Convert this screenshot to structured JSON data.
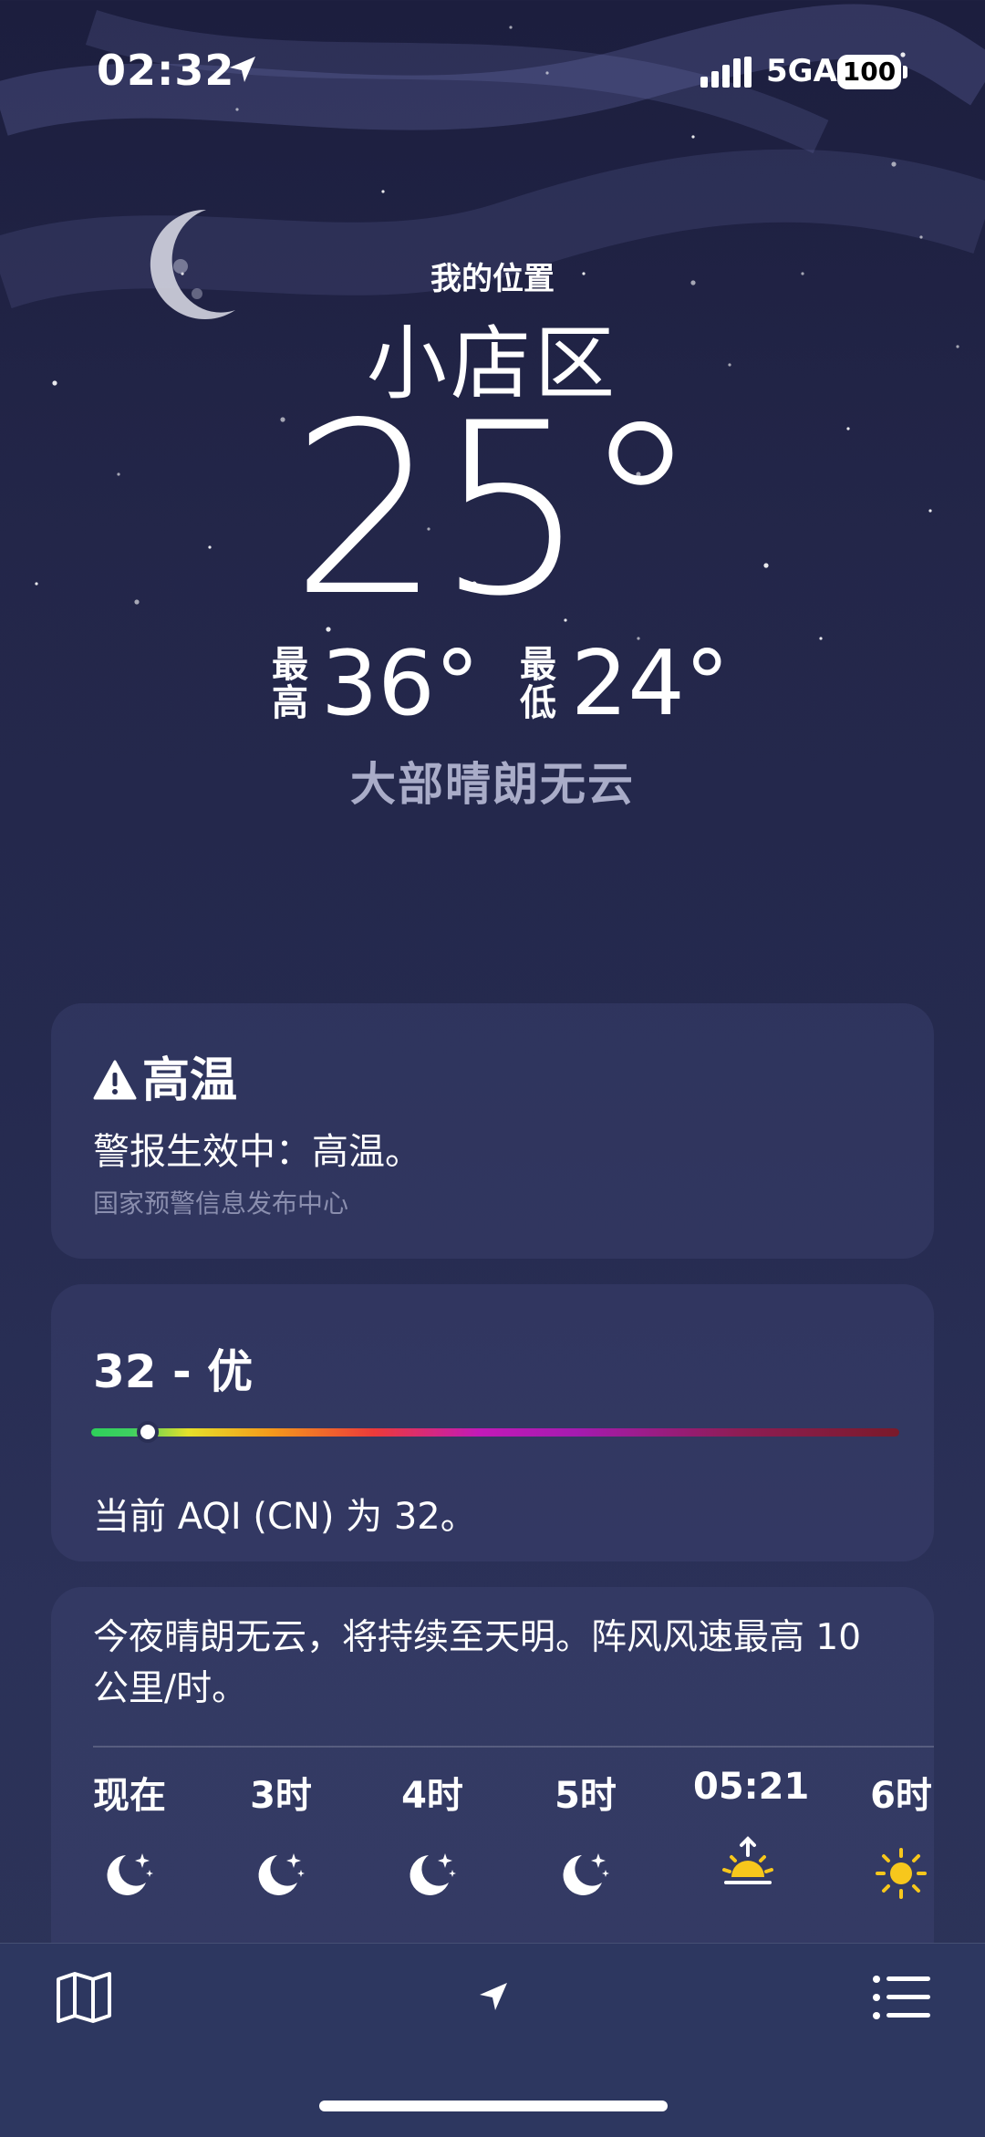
{
  "status_bar": {
    "time": "02:32",
    "network": "5GA",
    "battery": "100"
  },
  "header": {
    "my_location": "我的位置",
    "city": "小店区",
    "temperature": "25°",
    "high_label": "最高",
    "high": "36°",
    "low_label": "最低",
    "low": "24°",
    "condition": "大部晴朗无云"
  },
  "alert": {
    "title": "高温",
    "body": "警报生效中：高温。",
    "source": "国家预警信息发布中心"
  },
  "aqi": {
    "title": "32 - 优",
    "level_fraction": 0.07,
    "description": "当前 AQI (CN) 为 32。"
  },
  "forecast": {
    "summary": "今夜晴朗无云，将持续至天明。阵风风速最高 10 公里/时。",
    "hours": [
      {
        "label": "现在",
        "icon": "moon-stars-icon"
      },
      {
        "label": "3时",
        "icon": "moon-stars-icon"
      },
      {
        "label": "4时",
        "icon": "moon-stars-icon"
      },
      {
        "label": "5时",
        "icon": "moon-stars-icon"
      },
      {
        "label": "05:21",
        "icon": "sunrise-icon"
      },
      {
        "label": "6时",
        "icon": "sun-icon"
      }
    ]
  },
  "colors": {
    "sun": "#f7c71c",
    "aqi_good": "#2ed05a",
    "subtle_text": "#a9acc8"
  }
}
